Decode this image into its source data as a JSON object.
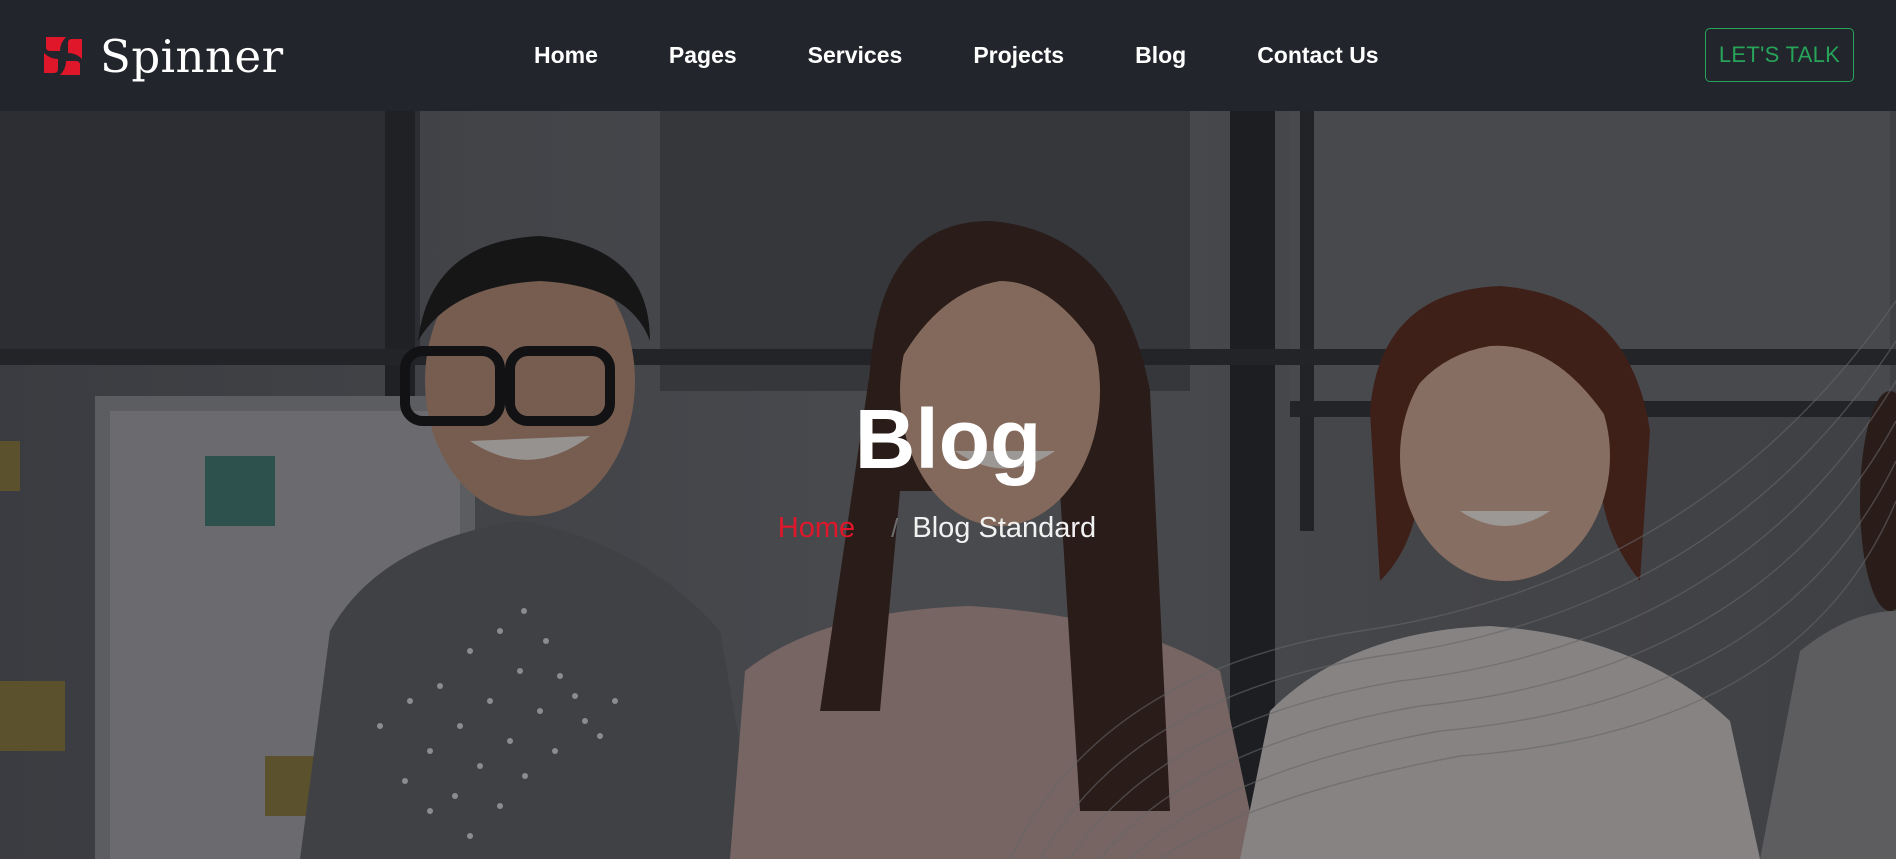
{
  "brand": {
    "name": "Spinner",
    "accent": "#e0162b"
  },
  "nav": {
    "items": [
      {
        "label": "Home"
      },
      {
        "label": "Pages"
      },
      {
        "label": "Services"
      },
      {
        "label": "Projects"
      },
      {
        "label": "Blog"
      },
      {
        "label": "Contact Us"
      }
    ],
    "cta_label": "LET'S TALK",
    "cta_color": "#27a35a"
  },
  "hero": {
    "title": "Blog",
    "breadcrumb": {
      "home": "Home",
      "separator": "/",
      "current": "Blog Standard"
    }
  }
}
